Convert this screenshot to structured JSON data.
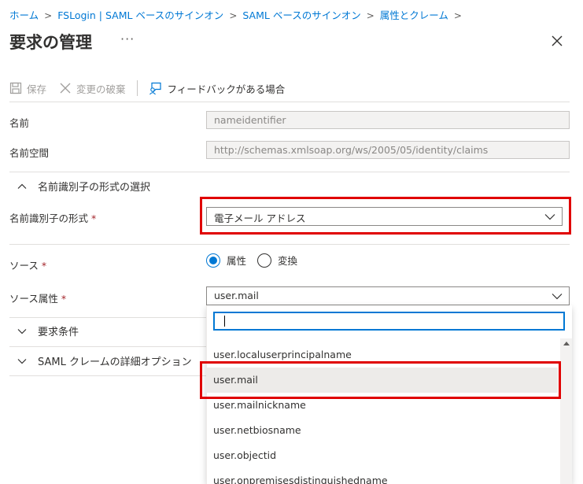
{
  "breadcrumb": {
    "items": [
      "ホーム",
      "FSLogin | SAML ベースのサインオン",
      "SAML ベースのサインオン",
      "属性とクレーム"
    ],
    "separator": ">"
  },
  "page": {
    "title": "要求の管理",
    "more": "···"
  },
  "toolbar": {
    "save": "保存",
    "discard": "変更の破棄",
    "feedback": "フィードバックがある場合"
  },
  "form": {
    "name_label": "名前",
    "name_value": "nameidentifier",
    "namespace_label": "名前空間",
    "namespace_value": "http://schemas.xmlsoap.org/ws/2005/05/identity/claims",
    "section_nameid": "名前識別子の形式の選択",
    "nameid_format_label": "名前識別子の形式",
    "nameid_format_value": "電子メール アドレス",
    "required_mark": "*",
    "source_label": "ソース",
    "source_options": [
      "属性",
      "変換"
    ],
    "source_selected": "属性",
    "source_attr_label": "ソース属性",
    "source_attr_value": "user.mail",
    "section_conditions": "要求条件",
    "section_advanced": "SAML クレームの詳細オプション"
  },
  "dropdown": {
    "search_value": "",
    "options": [
      "user.localuserprincipalname",
      "user.mail",
      "user.mailnickname",
      "user.netbiosname",
      "user.objectid",
      "user.onpremisesdistinguishedname"
    ],
    "selected": "user.mail"
  },
  "colors": {
    "accent": "#0078d4",
    "highlight": "#e00000",
    "required": "#a4262c"
  }
}
